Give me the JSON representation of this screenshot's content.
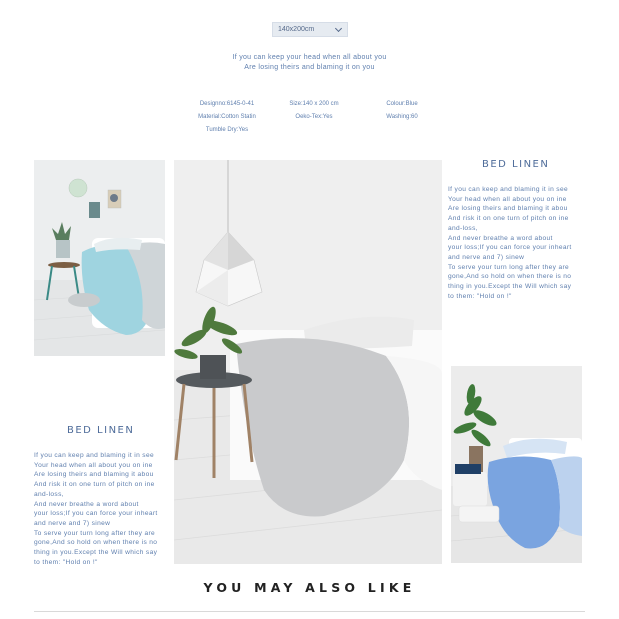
{
  "size_select": {
    "value": "140x200cm"
  },
  "intro_lines": [
    "If you can keep your head when all about you",
    "Are losing theirs and blaming it on you"
  ],
  "specs": {
    "designno": "Designno:6145-0-41",
    "size": "Size:140 x 200 cm",
    "colour": "Colour:Blue",
    "material": "Material:Cotton Statin",
    "oeko": "Oeko-Tex:Yes",
    "washing": "Washing:60",
    "tumble": "Tumble Dry:Yes"
  },
  "right_block": {
    "title": "BED LINEN",
    "lines": [
      "If you can keep and blaming it in see",
      "Your head when all about you on ine",
      "Are losing theirs and blaming it abou",
      "And risk it on one turn of pitch on ine",
      "and-loss,",
      "And never breathe a word about",
      "your loss;If you can force your inheart",
      " and nerve and 7) sinew",
      "To serve your turn long after they are",
      "gone,And so hold on when there is no",
      "thing in you.Except the Will which say",
      "to them: \"Hold on !\""
    ]
  },
  "left_block": {
    "title": "BED LINEN",
    "lines": [
      "If you can keep and blaming it in see",
      "Your head when all about you on ine",
      "Are losing theirs and blaming it abou",
      "And risk it on one turn of pitch on ine",
      "and-loss,",
      "And never breathe a word about",
      "your loss;If you can force your inheart",
      " and nerve and 7) sinew",
      "To serve your turn long after they are",
      "gone,And so hold on when there is no",
      "thing in you.Except the Will which say",
      "to them: \"Hold on !\""
    ]
  },
  "also_like": "YOU MAY ALSO LIKE",
  "colors": {
    "text_blue": "#5f7fae",
    "select_bg": "#e6ebf1",
    "duvet_grey": "#c9cacc",
    "duvet_aqua": "#9fd4e0",
    "duvet_blue": "#7aa4e0"
  }
}
